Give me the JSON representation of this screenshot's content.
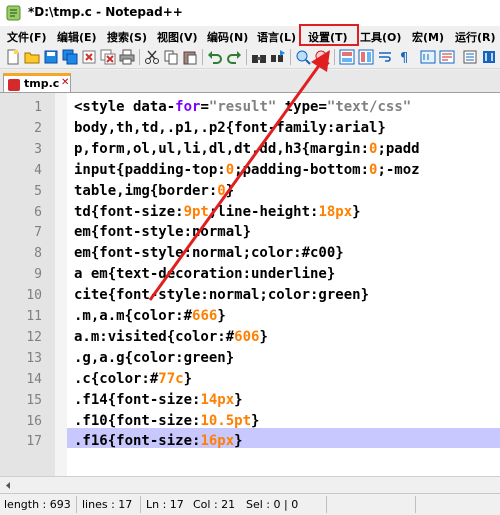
{
  "window": {
    "title": "*D:\\tmp.c - Notepad++"
  },
  "menu": {
    "items": [
      "文件(F)",
      "编辑(E)",
      "搜索(S)",
      "视图(V)",
      "编码(N)",
      "语言(L)",
      "设置(T)",
      "工具(O)",
      "宏(M)",
      "运行(R)"
    ],
    "highlighted": "设置(T)",
    "highlight_color": "#e02020"
  },
  "toolbar": {
    "icons": [
      "new-file-icon",
      "open-file-icon",
      "save-icon",
      "save-all-icon",
      "close-icon",
      "close-all-icon",
      "print-icon",
      "cut-icon",
      "copy-icon",
      "paste-icon",
      "undo-icon",
      "redo-icon",
      "find-icon",
      "replace-icon",
      "zoom-in-icon",
      "zoom-out-icon",
      "sync-v-icon",
      "sync-h-icon",
      "word-wrap-icon",
      "show-all-icon"
    ]
  },
  "tab": {
    "label": "tmp.c",
    "close": "✕"
  },
  "editor": {
    "line_numbers": [
      "1",
      "2",
      "3",
      "4",
      "5",
      "6",
      "7",
      "8",
      "9",
      "10",
      "11",
      "12",
      "13",
      "14",
      "15",
      "16",
      "17"
    ],
    "current_line": 17,
    "colors": {
      "keyword": "#8000ff",
      "string": "#808080",
      "number": "#ff8000",
      "text": "#000000",
      "selection": "#c8c8ff"
    },
    "lines": [
      [
        [
          "plain",
          "<style data-"
        ],
        [
          "kw",
          "for"
        ],
        [
          "plain",
          "="
        ],
        [
          "str",
          "\"result\""
        ],
        [
          "plain",
          " type="
        ],
        [
          "str",
          "\"text/css\""
        ]
      ],
      [
        [
          "plain",
          "body,th,td,.p1,.p2{font-family:arial}"
        ]
      ],
      [
        [
          "plain",
          "p,form,ol,ul,li,dl,dt,dd,h3{margin:"
        ],
        [
          "num",
          "0"
        ],
        [
          "plain",
          ";padd"
        ]
      ],
      [
        [
          "plain",
          "input{padding-top:"
        ],
        [
          "num",
          "0"
        ],
        [
          "plain",
          ";padding-bottom:"
        ],
        [
          "num",
          "0"
        ],
        [
          "plain",
          ";-moz"
        ]
      ],
      [
        [
          "plain",
          "table,img{border:"
        ],
        [
          "num",
          "0"
        ],
        [
          "plain",
          "}"
        ]
      ],
      [
        [
          "plain",
          "td{font-size:"
        ],
        [
          "num",
          "9pt"
        ],
        [
          "plain",
          ";line-height:"
        ],
        [
          "num",
          "18px"
        ],
        [
          "plain",
          "}"
        ]
      ],
      [
        [
          "plain",
          "em{font-style:normal}"
        ]
      ],
      [
        [
          "plain",
          "em{font-style:normal;color:#c00}"
        ]
      ],
      [
        [
          "plain",
          "a em{text-decoration:underline}"
        ]
      ],
      [
        [
          "plain",
          "cite{font-style:normal;color:green}"
        ]
      ],
      [
        [
          "plain",
          ".m,a.m{color:#"
        ],
        [
          "num",
          "666"
        ],
        [
          "plain",
          "}"
        ]
      ],
      [
        [
          "plain",
          "a.m:visited{color:#"
        ],
        [
          "num",
          "606"
        ],
        [
          "plain",
          "}"
        ]
      ],
      [
        [
          "plain",
          ".g,a.g{color:green}"
        ]
      ],
      [
        [
          "plain",
          ".c{color:#"
        ],
        [
          "num",
          "77c"
        ],
        [
          "plain",
          "}"
        ]
      ],
      [
        [
          "plain",
          ".f14{font-size:"
        ],
        [
          "num",
          "14px"
        ],
        [
          "plain",
          "}"
        ]
      ],
      [
        [
          "plain",
          ".f10{font-size:"
        ],
        [
          "num",
          "10.5pt"
        ],
        [
          "plain",
          "}"
        ]
      ],
      [
        [
          "plain",
          ".f16{font-size:"
        ],
        [
          "num",
          "16px"
        ],
        [
          "plain",
          "}"
        ]
      ]
    ]
  },
  "status": {
    "length": "length : 693",
    "lines": "lines : 17",
    "ln": "Ln : 17",
    "col": "Col : 21",
    "sel": "Sel : 0 | 0"
  },
  "annotation": {
    "arrow_color": "#e02020",
    "arrow_target": "设置(T)"
  }
}
